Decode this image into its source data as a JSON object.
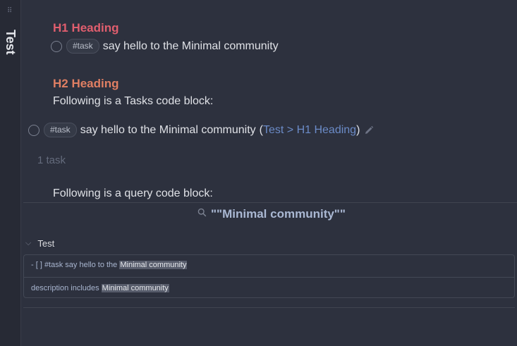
{
  "sidebar": {
    "title": "Test",
    "grip": "⠿"
  },
  "note": {
    "h1": "H1 Heading",
    "task1": {
      "tag": "#task",
      "text": "say hello to the Minimal community"
    },
    "h2": "H2 Heading",
    "tasks_intro": "Following is a Tasks code block:",
    "tasks_block": {
      "tag": "#task",
      "text": "say hello to the Minimal community",
      "paren_open": "(",
      "backlink": "Test > H1 Heading",
      "paren_close": ")",
      "count": "1 task"
    },
    "query_intro": "Following is a query code block:"
  },
  "search": {
    "query": "\"\"Minimal community\"\"",
    "group": "Test",
    "results": [
      {
        "prefix": "- [ ] #task say hello to the ",
        "match": "Minimal community"
      },
      {
        "prefix": "description includes ",
        "match": "Minimal community"
      }
    ]
  },
  "colors": {
    "background": "#2d313e",
    "h1": "#e05e6e",
    "h2": "#e07f63",
    "link": "#6b8bc7",
    "highlight": "#575c6b"
  }
}
